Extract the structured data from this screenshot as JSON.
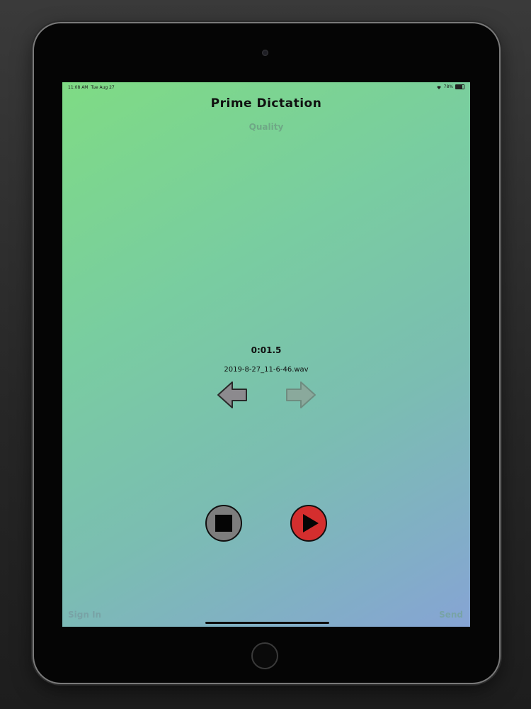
{
  "status_bar": {
    "time": "11:08 AM",
    "date": "Tue Aug 27",
    "battery_text": "78%",
    "battery_level": 0.78
  },
  "app": {
    "title": "Prime Dictation",
    "quality_label": "Quality"
  },
  "recording": {
    "duration": "0:01.5",
    "filename": "2019-8-27_11-6-46.wav"
  },
  "navigation": {
    "previous_icon": "left-arrow-icon",
    "next_icon": "right-arrow-icon"
  },
  "controls": {
    "stop_icon": "stop-icon",
    "play_icon": "play-icon"
  },
  "footer": {
    "sign_in_label": "Sign In",
    "send_label": "Send"
  },
  "colors": {
    "gradient_start": "#7fdb84",
    "gradient_end": "#86a4d4",
    "play_button": "#d42e2e",
    "stop_button": "#7d7d7d"
  }
}
